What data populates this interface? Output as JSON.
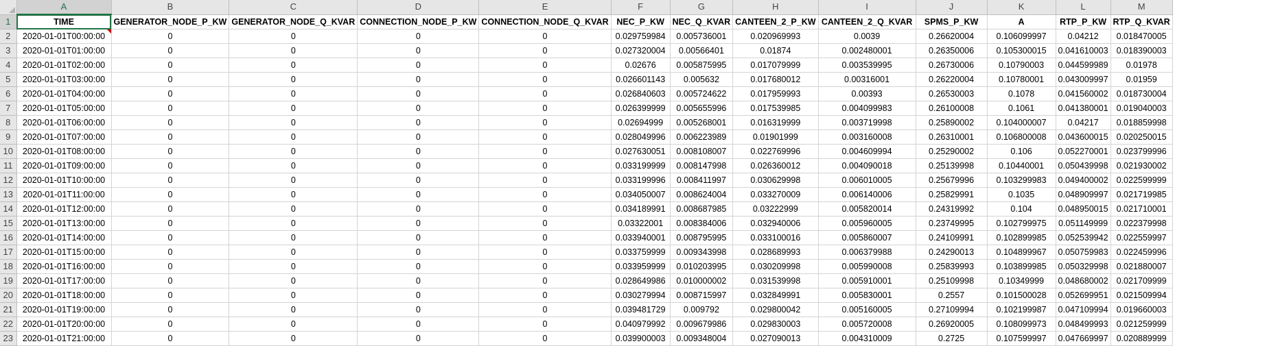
{
  "columns": [
    "A",
    "B",
    "C",
    "D",
    "E",
    "F",
    "G",
    "H",
    "I",
    "J",
    "K",
    "L",
    "M"
  ],
  "headers": [
    "TIME",
    "GENERATOR_NODE_P_KW",
    "GENERATOR_NODE_Q_KVAR",
    "CONNECTION_NODE_P_KW",
    "CONNECTION_NODE_Q_KVAR",
    "NEC_P_KW",
    "NEC_Q_KVAR",
    "CANTEEN_2_P_KW",
    "CANTEEN_2_Q_KVAR",
    "SPMS_P_KW",
    "A",
    "RTP_P_KW",
    "RTP_Q_KVAR"
  ],
  "rows": [
    [
      "2020-01-01T00:00:00",
      "0",
      "0",
      "0",
      "0",
      "0.029759984",
      "0.005736001",
      "0.020969993",
      "0.0039",
      "0.26620004",
      "0.106099997",
      "0.04212",
      "0.018470005"
    ],
    [
      "2020-01-01T01:00:00",
      "0",
      "0",
      "0",
      "0",
      "0.027320004",
      "0.00566401",
      "0.01874",
      "0.002480001",
      "0.26350006",
      "0.105300015",
      "0.041610003",
      "0.018390003"
    ],
    [
      "2020-01-01T02:00:00",
      "0",
      "0",
      "0",
      "0",
      "0.02676",
      "0.005875995",
      "0.017079999",
      "0.003539995",
      "0.26730006",
      "0.10790003",
      "0.044599989",
      "0.01978"
    ],
    [
      "2020-01-01T03:00:00",
      "0",
      "0",
      "0",
      "0",
      "0.026601143",
      "0.005632",
      "0.017680012",
      "0.00316001",
      "0.26220004",
      "0.10780001",
      "0.043009997",
      "0.01959"
    ],
    [
      "2020-01-01T04:00:00",
      "0",
      "0",
      "0",
      "0",
      "0.026840603",
      "0.005724622",
      "0.017959993",
      "0.00393",
      "0.26530003",
      "0.1078",
      "0.041560002",
      "0.018730004"
    ],
    [
      "2020-01-01T05:00:00",
      "0",
      "0",
      "0",
      "0",
      "0.026399999",
      "0.005655996",
      "0.017539985",
      "0.004099983",
      "0.26100008",
      "0.1061",
      "0.041380001",
      "0.019040003"
    ],
    [
      "2020-01-01T06:00:00",
      "0",
      "0",
      "0",
      "0",
      "0.02694999",
      "0.005268001",
      "0.016319999",
      "0.003719998",
      "0.25890002",
      "0.104000007",
      "0.04217",
      "0.018859998"
    ],
    [
      "2020-01-01T07:00:00",
      "0",
      "0",
      "0",
      "0",
      "0.028049996",
      "0.006223989",
      "0.01901999",
      "0.003160008",
      "0.26310001",
      "0.106800008",
      "0.043600015",
      "0.020250015"
    ],
    [
      "2020-01-01T08:00:00",
      "0",
      "0",
      "0",
      "0",
      "0.027630051",
      "0.008108007",
      "0.022769996",
      "0.004609994",
      "0.25290002",
      "0.106",
      "0.052270001",
      "0.023799996"
    ],
    [
      "2020-01-01T09:00:00",
      "0",
      "0",
      "0",
      "0",
      "0.033199999",
      "0.008147998",
      "0.026360012",
      "0.004090018",
      "0.25139998",
      "0.10440001",
      "0.050439998",
      "0.021930002"
    ],
    [
      "2020-01-01T10:00:00",
      "0",
      "0",
      "0",
      "0",
      "0.033199996",
      "0.008411997",
      "0.030629998",
      "0.006010005",
      "0.25679996",
      "0.103299983",
      "0.049400002",
      "0.022599999"
    ],
    [
      "2020-01-01T11:00:00",
      "0",
      "0",
      "0",
      "0",
      "0.034050007",
      "0.008624004",
      "0.033270009",
      "0.006140006",
      "0.25829991",
      "0.1035",
      "0.048909997",
      "0.021719985"
    ],
    [
      "2020-01-01T12:00:00",
      "0",
      "0",
      "0",
      "0",
      "0.034189991",
      "0.008687985",
      "0.03222999",
      "0.005820014",
      "0.24319992",
      "0.104",
      "0.048950015",
      "0.021710001"
    ],
    [
      "2020-01-01T13:00:00",
      "0",
      "0",
      "0",
      "0",
      "0.03322001",
      "0.008384006",
      "0.032940006",
      "0.005960005",
      "0.23749995",
      "0.102799975",
      "0.051149999",
      "0.022379998"
    ],
    [
      "2020-01-01T14:00:00",
      "0",
      "0",
      "0",
      "0",
      "0.033940001",
      "0.008795995",
      "0.033100016",
      "0.005860007",
      "0.24109991",
      "0.102899985",
      "0.052539942",
      "0.022559997"
    ],
    [
      "2020-01-01T15:00:00",
      "0",
      "0",
      "0",
      "0",
      "0.033759999",
      "0.009343998",
      "0.028689993",
      "0.006379988",
      "0.24290013",
      "0.104899967",
      "0.050759983",
      "0.022459996"
    ],
    [
      "2020-01-01T16:00:00",
      "0",
      "0",
      "0",
      "0",
      "0.033959999",
      "0.010203995",
      "0.030209998",
      "0.005990008",
      "0.25839993",
      "0.103899985",
      "0.050329998",
      "0.021880007"
    ],
    [
      "2020-01-01T17:00:00",
      "0",
      "0",
      "0",
      "0",
      "0.028649986",
      "0.010000002",
      "0.031539998",
      "0.005910001",
      "0.25109998",
      "0.10349999",
      "0.048680002",
      "0.021709999"
    ],
    [
      "2020-01-01T18:00:00",
      "0",
      "0",
      "0",
      "0",
      "0.030279994",
      "0.008715997",
      "0.032849991",
      "0.005830001",
      "0.2557",
      "0.101500028",
      "0.052699951",
      "0.021509994"
    ],
    [
      "2020-01-01T19:00:00",
      "0",
      "0",
      "0",
      "0",
      "0.039481729",
      "0.009792",
      "0.029800042",
      "0.005160005",
      "0.27109994",
      "0.102199987",
      "0.047109994",
      "0.019660003"
    ],
    [
      "2020-01-01T20:00:00",
      "0",
      "0",
      "0",
      "0",
      "0.040979992",
      "0.009679986",
      "0.029830003",
      "0.005720008",
      "0.26920005",
      "0.108099973",
      "0.048499993",
      "0.021259999"
    ],
    [
      "2020-01-01T21:00:00",
      "0",
      "0",
      "0",
      "0",
      "0.039900003",
      "0.009348004",
      "0.027090013",
      "0.004310009",
      "0.2725",
      "0.107599997",
      "0.047669997",
      "0.020889999"
    ]
  ]
}
